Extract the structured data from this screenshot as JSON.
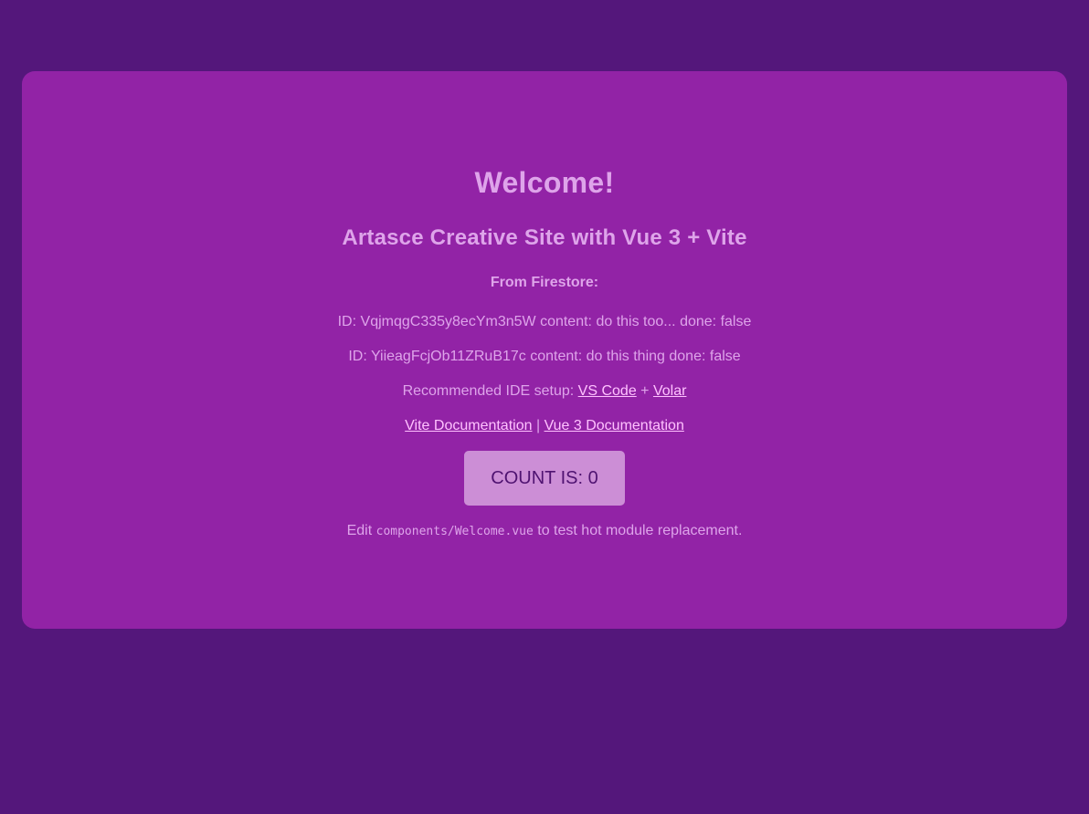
{
  "welcome": {
    "title": "Welcome!",
    "subtitle": "Artasce Creative Site with Vue 3 + Vite",
    "firestore_heading": "From Firestore:",
    "todos": [
      {
        "id_label": "ID:",
        "id": "VqjmqgC335y8ecYm3n5W",
        "content_label": "content:",
        "content": "do this too...",
        "done_label": "done:",
        "done": "false"
      },
      {
        "id_label": "ID:",
        "id": "YiieagFcjOb11ZRuB17c",
        "content_label": "content:",
        "content": "do this thing",
        "done_label": "done:",
        "done": "false"
      }
    ],
    "ide": {
      "prefix": "Recommended IDE setup:",
      "vscode": "VS Code",
      "plus": "+",
      "volar": "Volar"
    },
    "docs": {
      "vite": "Vite Documentation",
      "separator": "|",
      "vue": "Vue 3 Documentation"
    },
    "counter": {
      "label": "COUNT IS:",
      "value": "0"
    },
    "edit": {
      "prefix": "Edit",
      "path": "components/Welcome.vue",
      "suffix": "to test hot module replacement."
    }
  },
  "colors": {
    "page_bg": "#54177b",
    "card_bg": "#9223a6",
    "text": "#dea4ea",
    "link": "#ffc1ff",
    "button_bg": "#cc8ed6",
    "button_text": "#4f1371"
  }
}
